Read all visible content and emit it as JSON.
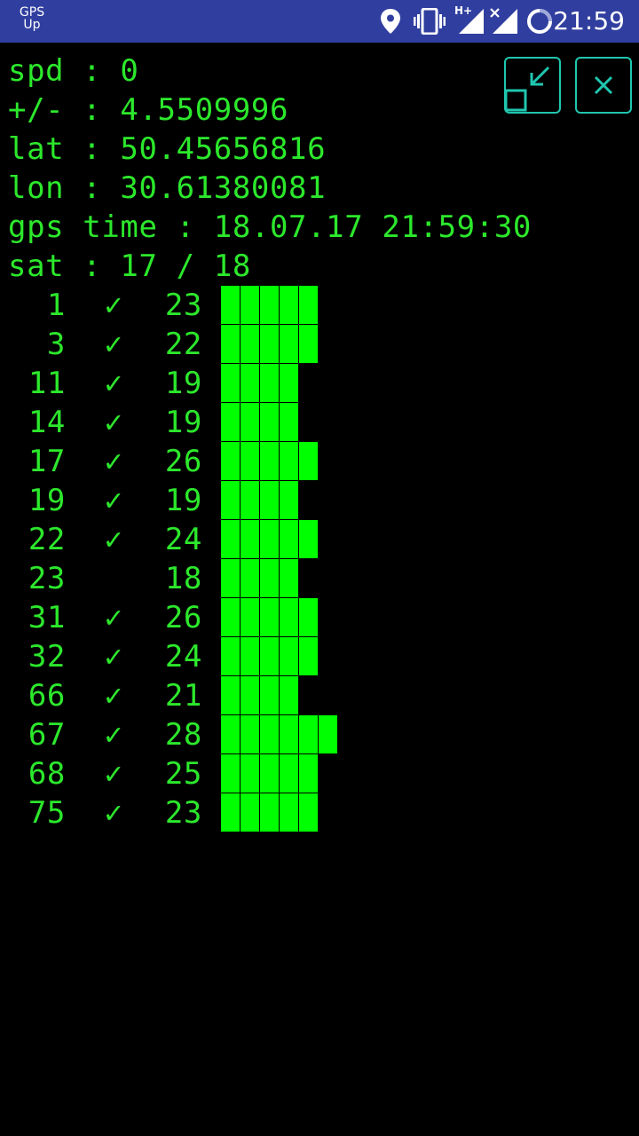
{
  "status_bar": {
    "app_tag_line1": "GPS",
    "app_tag_line2": "Up",
    "network_label": "H+",
    "time": "21:59",
    "icons": [
      "location-icon",
      "vibrate-icon",
      "signal-h-plus-icon",
      "signal-x-icon",
      "sync-icon"
    ],
    "bg_color": "#303f9f"
  },
  "info": {
    "speed": "spd : 0",
    "accuracy": "+/- : 4.5509996",
    "lat": "lat : 50.45656816",
    "lon": "lon : 30.61380081",
    "gps_time": "gps time : 18.07.17 21:59:30",
    "sat": "sat : 17 / 18"
  },
  "buttons": {
    "minimize_icon": "collapse-window-icon",
    "close_icon": "close-icon",
    "accent_color": "#20c7b0"
  },
  "satellites": [
    {
      "id": "1",
      "used": "✓",
      "snr": "23",
      "bars": 5
    },
    {
      "id": "3",
      "used": "✓",
      "snr": "22",
      "bars": 5
    },
    {
      "id": "11",
      "used": "✓",
      "snr": "19",
      "bars": 4
    },
    {
      "id": "14",
      "used": "✓",
      "snr": "19",
      "bars": 4
    },
    {
      "id": "17",
      "used": "✓",
      "snr": "26",
      "bars": 5
    },
    {
      "id": "19",
      "used": "✓",
      "snr": "19",
      "bars": 4
    },
    {
      "id": "22",
      "used": "✓",
      "snr": "24",
      "bars": 5
    },
    {
      "id": "23",
      "used": "",
      "snr": "18",
      "bars": 4
    },
    {
      "id": "31",
      "used": "✓",
      "snr": "26",
      "bars": 5
    },
    {
      "id": "32",
      "used": "✓",
      "snr": "24",
      "bars": 5
    },
    {
      "id": "66",
      "used": "✓",
      "snr": "21",
      "bars": 4
    },
    {
      "id": "67",
      "used": "✓",
      "snr": "28",
      "bars": 6
    },
    {
      "id": "68",
      "used": "✓",
      "snr": "25",
      "bars": 5
    },
    {
      "id": "75",
      "used": "✓",
      "snr": "23",
      "bars": 5
    }
  ],
  "colors": {
    "text": "#2ce82c",
    "bar": "#00ff00",
    "background": "#000000"
  }
}
